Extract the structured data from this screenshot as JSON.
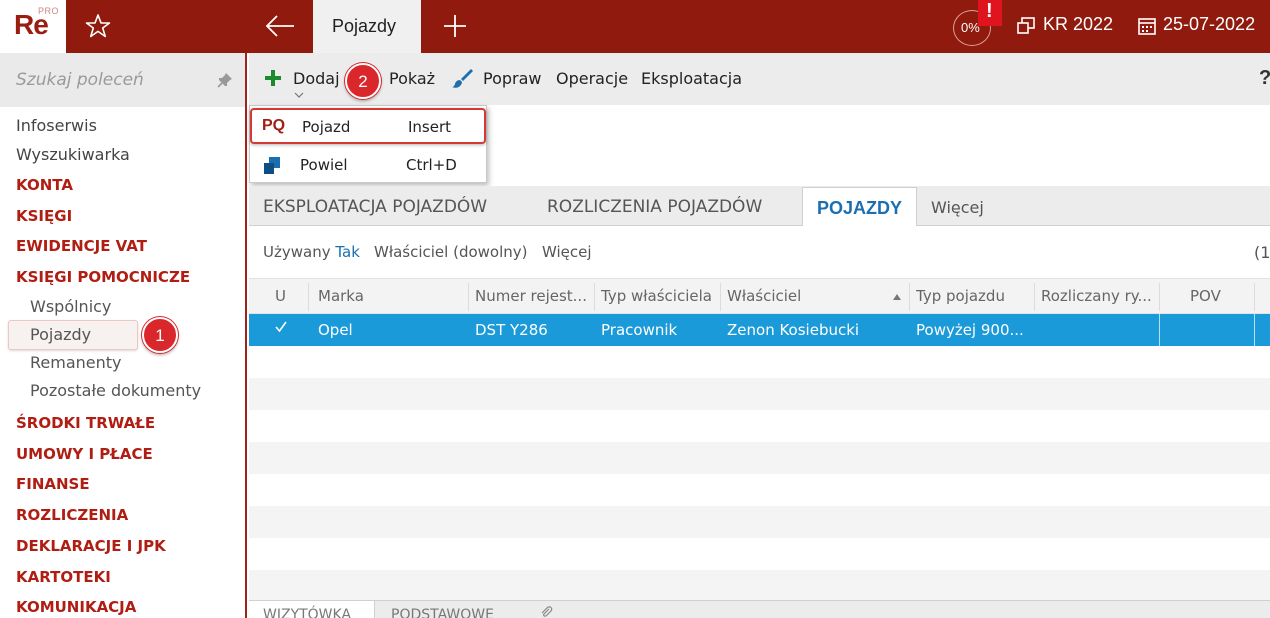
{
  "topbar": {
    "logo_main": "Re",
    "logo_pro": "PRO",
    "active_tab": "Pojazdy",
    "progress_label": "0%",
    "alert_mark": "!",
    "company": "KR 2022",
    "date": "25-07-2022",
    "brand_color": "#8f1a0d"
  },
  "sidebar": {
    "search_placeholder": "Szukaj poleceń",
    "items": [
      {
        "label": "Infoserwis",
        "kind": "plain"
      },
      {
        "label": "Wyszukiwarka",
        "kind": "plain"
      },
      {
        "label": "KONTA",
        "kind": "group"
      },
      {
        "label": "KSIĘGI",
        "kind": "group"
      },
      {
        "label": "EWIDENCJE VAT",
        "kind": "group"
      },
      {
        "label": "KSIĘGI POMOCNICZE",
        "kind": "group"
      },
      {
        "label": "Wspólnicy",
        "kind": "sub"
      },
      {
        "label": "Pojazdy",
        "kind": "sub",
        "selected": true
      },
      {
        "label": "Remanenty",
        "kind": "sub"
      },
      {
        "label": "Pozostałe dokumenty",
        "kind": "sub"
      },
      {
        "label": "ŚRODKI TRWAŁE",
        "kind": "group"
      },
      {
        "label": "UMOWY I PŁACE",
        "kind": "group"
      },
      {
        "label": "FINANSE",
        "kind": "group"
      },
      {
        "label": "ROZLICZENIA",
        "kind": "group"
      },
      {
        "label": "DEKLARACJE I JPK",
        "kind": "group"
      },
      {
        "label": "KARTOTEKI",
        "kind": "group"
      },
      {
        "label": "KOMUNIKACJA",
        "kind": "group"
      }
    ]
  },
  "badges": {
    "one": "1",
    "two": "2"
  },
  "toolbar": {
    "add": "Dodaj",
    "show": "Pokaż",
    "edit": "Popraw",
    "operations": "Operacje",
    "exploitation": "Eksploatacja",
    "help": "?"
  },
  "dropdown": {
    "items": [
      {
        "icon": "PQ",
        "label": "Pojazd",
        "shortcut": "Insert"
      },
      {
        "icon": "copy-icon",
        "label": "Powiel",
        "shortcut": "Ctrl+D"
      }
    ]
  },
  "tabs": {
    "t1": "EKSPLOATACJA POJAZDÓW",
    "t2": "ROZLICZENIA POJAZDÓW",
    "t3": "POJAZDY",
    "t4": "Więcej"
  },
  "filters": {
    "used_label": "Używany",
    "used_value": "Tak",
    "owner": "Właściciel (dowolny)",
    "more": "Więcej",
    "count_partial": "(1"
  },
  "grid": {
    "columns": [
      "U",
      "Marka",
      "Numer rejest...",
      "Typ właściciela",
      "Właściciel",
      "Typ pojazdu",
      "Rozliczany ry...",
      "POV"
    ],
    "rows": [
      {
        "brand": "Opel",
        "reg": "DST Y286",
        "owner_type": "Pracownik",
        "owner": "Zenon Kosiebucki",
        "vehicle_type": "Powyżej 900..."
      }
    ],
    "selected_color": "#1a9ad9"
  },
  "bottom_tabs": {
    "b1": "WIZYTÓWKA",
    "b2": "PODSTAWOWE"
  }
}
